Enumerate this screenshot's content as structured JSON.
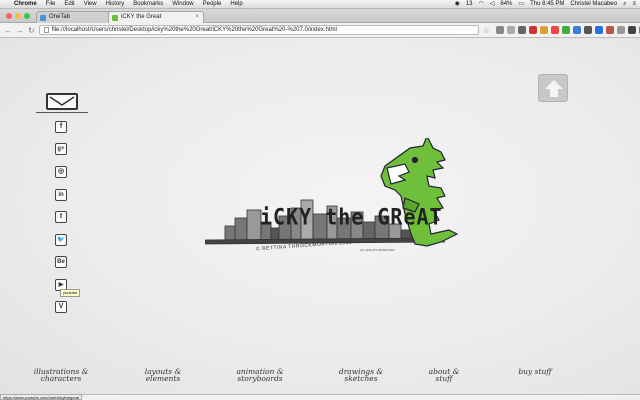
{
  "menubar": {
    "app": "Chrome",
    "items": [
      "Chrome",
      "File",
      "Edit",
      "View",
      "History",
      "Bookmarks",
      "Window",
      "People",
      "Help"
    ],
    "battery": "64%",
    "clock": "Thu 8:45 PM",
    "user": "Christel Macabeo",
    "badge": "13"
  },
  "tabs": [
    {
      "label": "OneTab",
      "active": false
    },
    {
      "label": "iCKY the Great",
      "active": true
    }
  ],
  "toolbar": {
    "url": "file:///localhost/Users/christel/Desktop/icky%20the%20Great/iCKY%20the%20Great%20-%207.0/index.html"
  },
  "site": {
    "title": "iCKY the GReAT",
    "subtitle": "© BETTINA THROCKMORTON 2012",
    "rights": "ALL RIGHTS RESERVED",
    "tooltip": "youtube",
    "social": [
      "f",
      "g+",
      "◎",
      "in",
      "t",
      "🐦",
      "Be",
      "▶",
      "V"
    ],
    "nav": [
      {
        "line1": "illustrations &",
        "line2": "characters"
      },
      {
        "line1": "layouts &",
        "line2": "elements"
      },
      {
        "line1": "animation &",
        "line2": "storyboards"
      },
      {
        "line1": "drawings &",
        "line2": "sketches"
      },
      {
        "line1": "about &",
        "line2": "stuff"
      },
      {
        "line1": "buy stuff",
        "line2": ""
      }
    ]
  },
  "statusbar": {
    "hover_url": "https://www.youtube.com/user/ickythegreat"
  },
  "colors": {
    "dino": "#6fbf3a",
    "accent": "#333333"
  }
}
